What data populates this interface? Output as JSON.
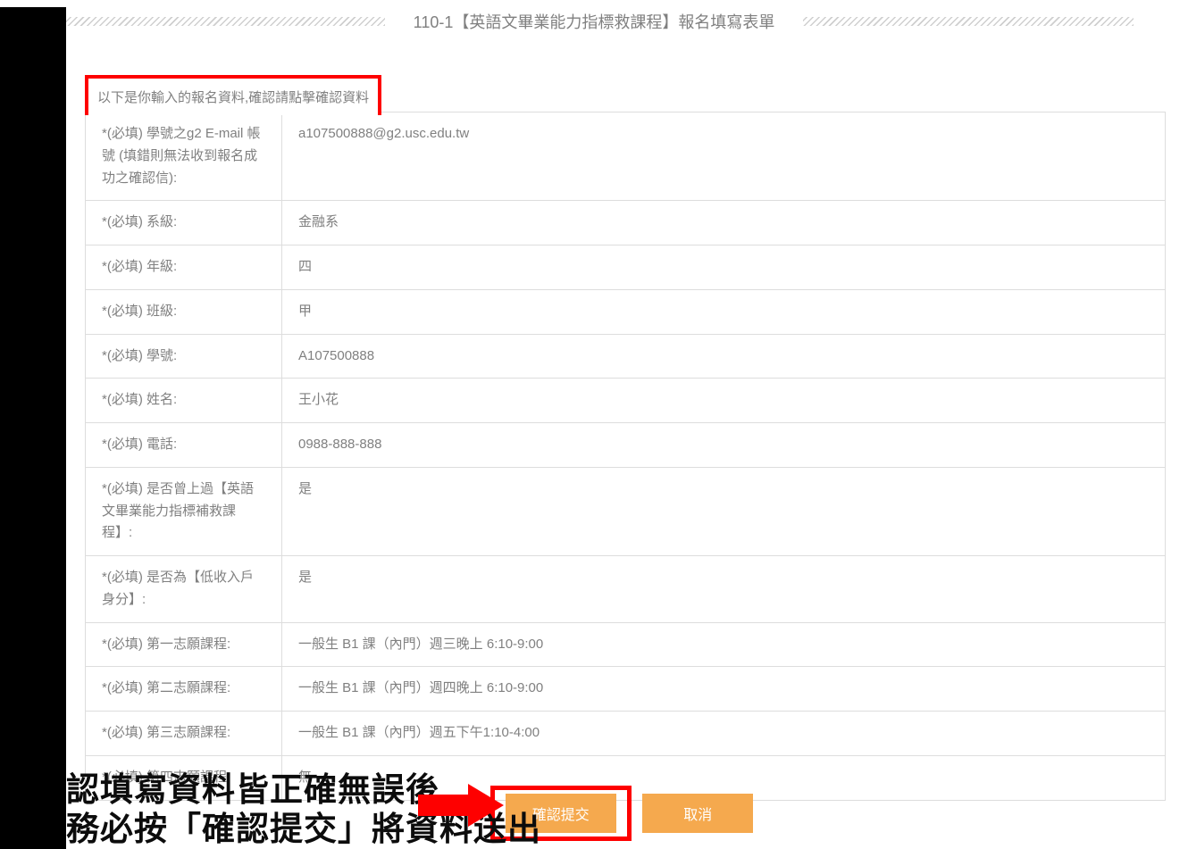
{
  "title": "110-1【英語文畢業能力指標救課程】報名填寫表單",
  "confirm_header": "以下是你輸入的報名資料,確認請點擊確認資料",
  "rows": [
    {
      "label": "*(必填) 學號之g2 E-mail 帳號 (填錯則無法收到報名成功之確認信):",
      "value": "a107500888@g2.usc.edu.tw"
    },
    {
      "label": "*(必填) 系級:",
      "value": "金融系"
    },
    {
      "label": "*(必填) 年級:",
      "value": "四"
    },
    {
      "label": "*(必填) 班級:",
      "value": "甲"
    },
    {
      "label": "*(必填) 學號:",
      "value": "A107500888"
    },
    {
      "label": "*(必填) 姓名:",
      "value": "王小花"
    },
    {
      "label": "*(必填) 電話:",
      "value": "0988-888-888"
    },
    {
      "label": "*(必填) 是否曾上過【英語文畢業能力指標補救課程】:",
      "value": "是"
    },
    {
      "label": "*(必填) 是否為【低收入戶身分】:",
      "value": "是"
    },
    {
      "label": "*(必填) 第一志願課程:",
      "value": "一般生 B1 課（內門）週三晚上 6:10-9:00"
    },
    {
      "label": "*(必填) 第二志願課程:",
      "value": "一般生 B1 課（內門）週四晚上 6:10-9:00"
    },
    {
      "label": "*(必填) 第三志願課程:",
      "value": "一般生 B1 課（內門）週五下午1:10-4:00"
    },
    {
      "label": "*(必填) 第四志願課程:",
      "value": "無"
    }
  ],
  "buttons": {
    "confirm": "確認提交",
    "cancel": "取消"
  },
  "overlay": {
    "line1": "認填寫資料皆正確無誤後",
    "line2": "務必按「確認提交」將資料送出"
  }
}
